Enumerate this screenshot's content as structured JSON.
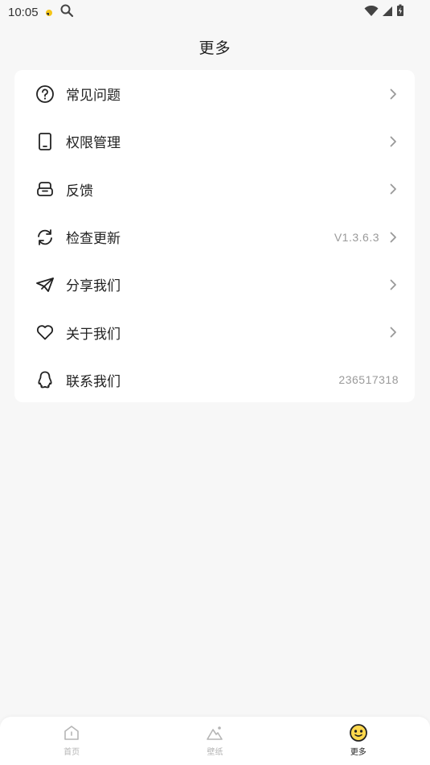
{
  "status": {
    "time": "10:05"
  },
  "header": {
    "title": "更多"
  },
  "menu": [
    {
      "label": "常见问题",
      "value": "",
      "icon": "question-circle-icon",
      "chevron": true
    },
    {
      "label": "权限管理",
      "value": "",
      "icon": "phone-device-icon",
      "chevron": true
    },
    {
      "label": "反馈",
      "value": "",
      "icon": "inbox-tray-icon",
      "chevron": true
    },
    {
      "label": "检查更新",
      "value": "V1.3.6.3",
      "icon": "refresh-icon",
      "chevron": true
    },
    {
      "label": "分享我们",
      "value": "",
      "icon": "paper-plane-icon",
      "chevron": true
    },
    {
      "label": "关于我们",
      "value": "",
      "icon": "heart-icon",
      "chevron": true
    },
    {
      "label": "联系我们",
      "value": "236517318",
      "icon": "qq-penguin-icon",
      "chevron": false
    }
  ],
  "tabbar": {
    "items": [
      {
        "label": "首页",
        "active": false,
        "icon": "home-icon"
      },
      {
        "label": "壁纸",
        "active": false,
        "icon": "mountain-icon"
      },
      {
        "label": "更多",
        "active": true,
        "icon": "smiley-face-icon"
      }
    ]
  },
  "colors": {
    "accent": "#ffd84d",
    "text": "#222222",
    "muted": "#9a9a9a",
    "background": "#f7f7f7"
  }
}
